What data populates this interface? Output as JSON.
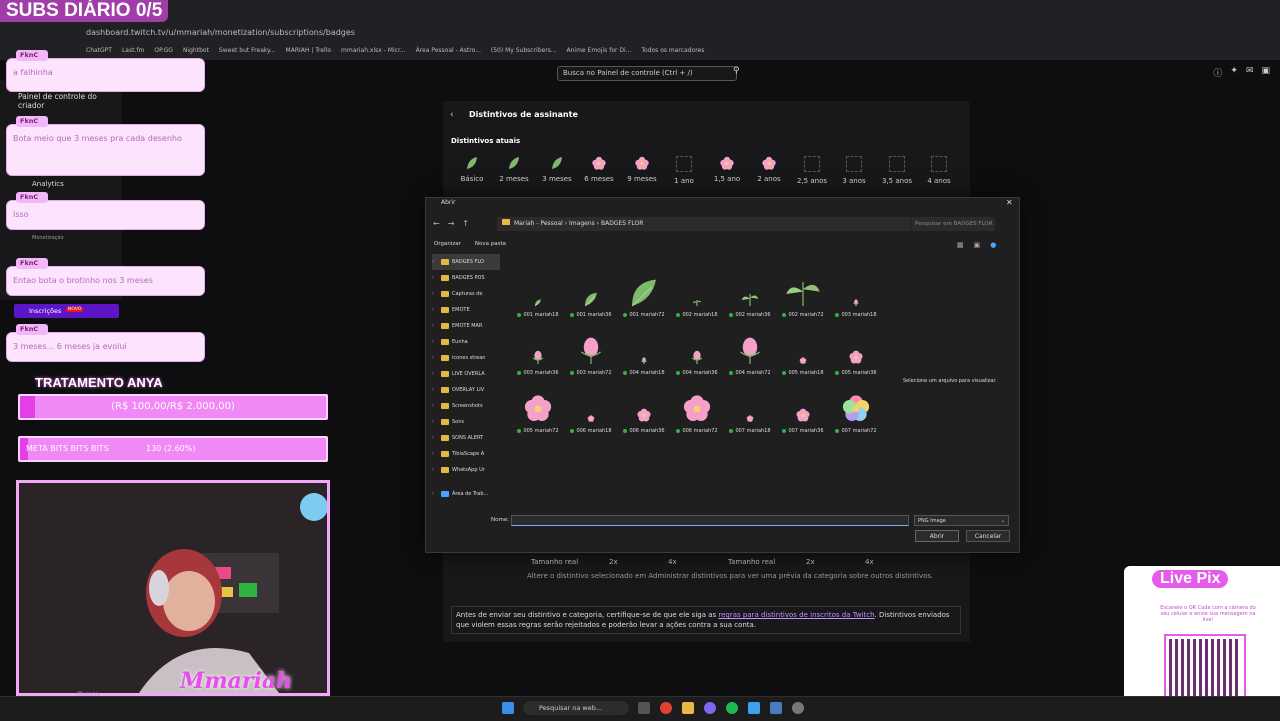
{
  "stream": {
    "title": "SUBS DIÁRIO 0/5",
    "chat": [
      {
        "user": "FknC",
        "message": "a falhinha"
      },
      {
        "user": "FknC",
        "message": "Bota meio que 3 meses pra cada desenho"
      },
      {
        "user": "FknC",
        "message": "Isso"
      },
      {
        "user": "FknC",
        "message": "Entao bota o brotinho nos 3 meses"
      },
      {
        "user": "FknC",
        "message": "3 meses... 6 meses ja evolui"
      }
    ],
    "goal": {
      "title": "TRATAMENTO ANYA",
      "text": "(R$ 100,00/R$ 2.000,00)",
      "progress": 0.05
    },
    "bits": {
      "label": "META BITS BITS BITS",
      "value": "130 (2.60%)",
      "progress": 0.026
    },
    "cam_name": "Mmariah",
    "cam_handle": "@mm",
    "pix": {
      "title": "Live Pix",
      "desc": "Escaneie o QR Code com a câmera do seu celular e envie sua mensagem na live!"
    }
  },
  "browser": {
    "url": "dashboard.twitch.tv/u/mmariah/monetization/subscriptions/badges",
    "bookmarks": [
      "ChatGPT",
      "Last.fm",
      "OP.GG",
      "Nightbot",
      "Sweet but Freaky...",
      "MARIAH | Trello",
      "mmariah.xlsx - Micr...",
      "Área Pessoal - Astro...",
      "(50) My Subscribers...",
      "Anime Emojis for Di...",
      "Todos os marcadores"
    ]
  },
  "twitch": {
    "search_placeholder": "Busca no Painel de controle (Ctrl + /)",
    "sidebar": {
      "creator": "Painel de controle do criador",
      "analytics": "Analytics",
      "monetization": "Monetização",
      "subscriptions": "Inscrições",
      "new_badge": "NOVO"
    },
    "panel_title": "Distintivos de assinante",
    "current_badges_title": "Distintivos atuais",
    "badge_tiers": [
      "Básico",
      "2 meses",
      "3 meses",
      "6 meses",
      "9 meses",
      "1 ano",
      "1,5 ano",
      "2 anos",
      "2,5 anos",
      "3 anos",
      "3,5 anos",
      "4 anos"
    ],
    "size_labels": [
      "Tamanho real",
      "2x",
      "4x",
      "Tamanho real",
      "2x",
      "4x"
    ],
    "lower_hint": "Altere o distintivo selecionado em Administrar distintivos para ver uma prévia da categoria sobre outros distintivos.",
    "rules_prefix": "Antes de enviar seu distintivo e categoria, certifique-se de que ele siga as ",
    "rules_link": "regras para distintivos de inscritos da Twitch",
    "rules_suffix": ". Distintivos enviados que violem essas regras serão rejeitados e poderão levar a ações contra a sua conta."
  },
  "dialog": {
    "title": "Abrir",
    "path": [
      "Mariah - Pessoal",
      "Imagens",
      "BADGES FLOR"
    ],
    "search_placeholder": "Pesquisar em BADGES FLOR",
    "toolbar": [
      "Organizar",
      "Nova pasta"
    ],
    "tree": [
      "BADGES FLO",
      "BADGES POS",
      "Capturas de",
      "EMOTE",
      "EMOTE MAR",
      "Eunha",
      "icones strean",
      "LIVE OVERLA",
      "OVERLAY LIV",
      "Screenshots",
      "Sons",
      "SONS ALERT",
      "TibiaScape A",
      "WhatsApp Ur",
      "Área de Trab..."
    ],
    "files": [
      "001 mariah18",
      "001 mariah36",
      "001 mariah72",
      "002 mariah18",
      "002 mariah36",
      "002 mariah72",
      "003 mariah18",
      "003 mariah36",
      "003 mariah72",
      "004 mariah18",
      "004 mariah36",
      "004 mariah72",
      "005 mariah18",
      "005 mariah36",
      "005 mariah72",
      "006 mariah18",
      "006 mariah36",
      "006 mariah72",
      "007 mariah18",
      "007 mariah36",
      "007 mariah72"
    ],
    "preview_hint": "Selecione um arquivo para visualizar.",
    "name_label": "Nome:",
    "file_type": "PNG Image",
    "open_label": "Abrir",
    "cancel_label": "Cancelar"
  },
  "taskbar": {
    "search_placeholder": "Pesquisar na web..."
  },
  "colors": {
    "twitch_purple": "#bf94ff",
    "overlay_pink": "#e23fe8",
    "leaf_green": "#7fb96b",
    "flower_pink": "#f4a0c8"
  }
}
